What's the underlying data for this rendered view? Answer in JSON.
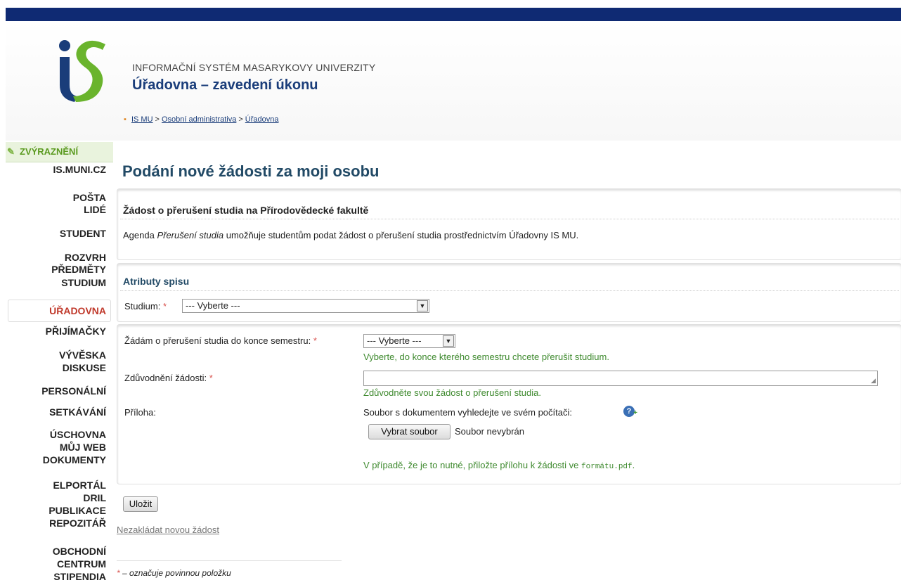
{
  "header": {
    "system_title": "INFORMAČNÍ SYSTÉM MASARYKOVY UNIVERZITY",
    "app_title": "Úřadovna – zavedení úkonu",
    "breadcrumb": [
      "IS MU",
      "Osobní administrativa",
      "Úřadovna"
    ],
    "breadcrumb_sep": ">"
  },
  "sidebar": {
    "highlight_label": "ZVÝRAZNĚNÍ",
    "items": [
      "IS.MUNI.CZ",
      "POŠTA",
      "LIDÉ",
      "STUDENT",
      "ROZVRH",
      "PŘEDMĚTY",
      "STUDIUM",
      "ÚŘADOVNA",
      "PŘIJÍMAČKY",
      "VÝVĚSKA",
      "DISKUSE",
      "PERSONÁLNÍ",
      "SETKÁVÁNÍ",
      "ÚSCHOVNA",
      "MŮJ WEB",
      "DOKUMENTY",
      "ELPORTÁL",
      "DRIL",
      "PUBLIKACE",
      "REPOZITÁŘ",
      "OBCHODNÍ",
      "CENTRUM",
      "STIPENDIA"
    ],
    "active": "ÚŘADOVNA"
  },
  "main": {
    "page_title": "Podání nové žádosti za moji osobu",
    "request_heading": "Žádost o přerušení studia na Přírodovědecké fakultě",
    "desc_prefix": "Agenda ",
    "desc_italic": "Přerušení studia",
    "desc_suffix": " umožňuje studentům podat žádost o přerušení studia prostřednictvím Úřadovny IS MU.",
    "attributes_heading": "Atributy spisu",
    "studium_label": "Studium:",
    "studium_value": "--- Vyberte ---",
    "required_mark": "*",
    "semester_label": "Žádám o přerušení studia do konce semestru:",
    "semester_value": "--- Vyberte ---",
    "semester_hint": "Vyberte, do konce kterého semestru chcete přerušit studium.",
    "reason_label": "Zdůvodnění žádosti:",
    "reason_value": "",
    "reason_hint": "Zdůvodněte svou žádost o přerušení studia.",
    "attachment_label": "Příloha:",
    "attachment_prompt": "Soubor s dokumentem vyhledejte ve svém počítači:",
    "file_button": "Vybrat soubor",
    "file_status": "Soubor nevybrán",
    "attachment_hint_prefix": "V případě, že je to nutné, přiložte přílohu k žádosti ve ",
    "attachment_hint_code": "formátu.pdf",
    "attachment_hint_suffix": ".",
    "save_button": "Uložit",
    "cancel_link": "Nezakládat novou žádost",
    "footnote_mark": "*",
    "footnote_text": " – označuje povinnou položku"
  },
  "colors": {
    "topbar": "#0f2a73",
    "logo_blue": "#1a3d7a",
    "logo_green": "#6ab42d",
    "hint_green": "#3f8a2f",
    "active_red": "#c0392b"
  }
}
